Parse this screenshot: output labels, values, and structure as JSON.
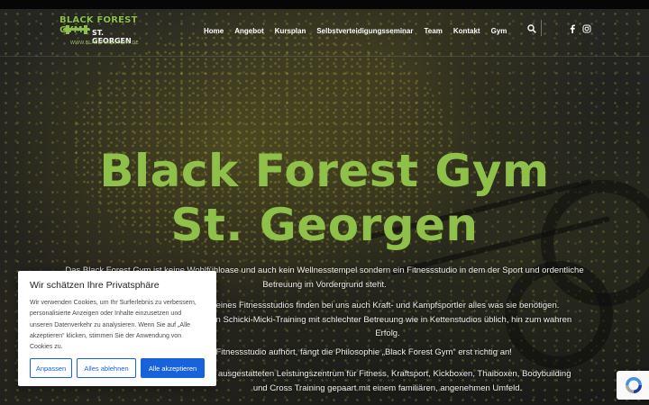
{
  "header": {
    "logo": {
      "line1": "BLACK FOREST GYM",
      "line2": "ST. GEORGEN",
      "url": "WWW.BLACKFORESTGYM.DE",
      "accent_color": "#8fc04a"
    },
    "nav": [
      {
        "label": "Home"
      },
      {
        "label": "Angebot"
      },
      {
        "label": "Kursplan"
      },
      {
        "label": "Selbstverteidigungsseminar"
      },
      {
        "label": "Team"
      },
      {
        "label": "Kontakt"
      },
      {
        "label": "Gym"
      }
    ],
    "search_icon": "search-icon",
    "social": [
      {
        "icon": "facebook-icon"
      },
      {
        "icon": "instagram-icon"
      }
    ]
  },
  "hero": {
    "title_line1": "Black Forest Gym",
    "title_line2": "St. Georgen",
    "title_color": "#8fc04a",
    "paragraph1_line1": "Das Black Forest Gym ist keine Wohlfühloase und auch kein Wellnesstempel sondern ein Fitnessstudio in dem der Sport und ordentliche",
    "paragraph1_line2": "Betreuung im Vordergrund steht.",
    "paragraph2_line1": "eines Fitnessstudios finden bei uns auch Kraft- und Kampfsportler alles was sie benötigen.",
    "paragraph2_line2": "dern Schicki-Micki-Training mit schlechter Betreuung wie in Kettenstudios üblich, hin zum wahren",
    "paragraph2_line3": "Erfolg.",
    "paragraph3": "s Fitnessstudio aufhört, fängt die Philosophie „Black Forest Gym“ erst richtig an!",
    "paragraph4_line1": "nal ausgestatteten Leistungszentrum für Fitness, Kraftsport, Kickboxen, Thaiboxen, Bodybuilding",
    "paragraph4_line2": "und Cross Training gepaart mit einem familiären, angenehmen Umfeld."
  },
  "cookie_banner": {
    "title": "Wir schätzen Ihre Privatsphäre",
    "text": "Wir verwenden Cookies, um Ihr Surferlebnis zu verbessern, personalisierte Anzeigen oder Inhalte einzusetzen und unseren Datenverkehr zu analysieren. Wenn Sie auf „Alle akzeptieren“ klicken, stimmen Sie der Anwendung von Cookies zu.",
    "buttons": {
      "customize": "Anpassen",
      "reject": "Alles ablehnen",
      "accept": "Alle akzeptieren"
    },
    "accent_color": "#1863dc"
  },
  "recaptcha": {
    "icon": "recaptcha-icon"
  }
}
